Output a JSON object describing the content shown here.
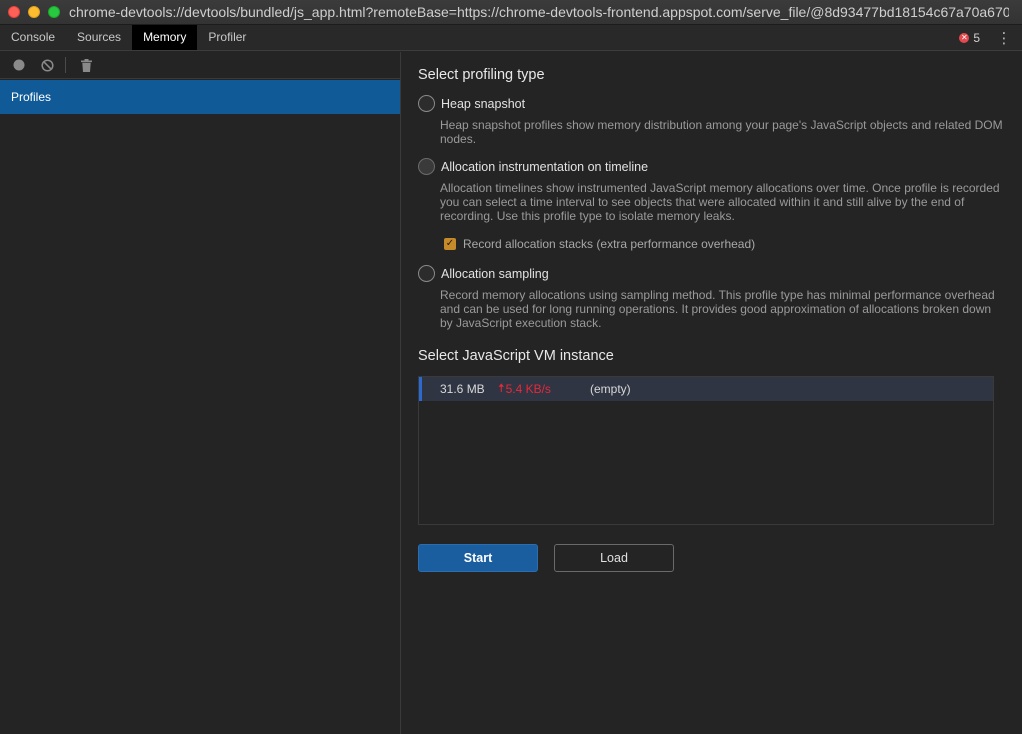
{
  "window": {
    "title": "chrome-devtools://devtools/bundled/js_app.html?remoteBase=https://chrome-devtools-frontend.appspot.com/serve_file/@8d93477bd18154c67a70a67019c..."
  },
  "tabs": [
    {
      "label": "Console"
    },
    {
      "label": "Sources"
    },
    {
      "label": "Memory"
    },
    {
      "label": "Profiler"
    }
  ],
  "error_count": "5",
  "sidebar": {
    "profiles_label": "Profiles"
  },
  "main": {
    "select_type_heading": "Select profiling type",
    "options": [
      {
        "label": "Heap snapshot",
        "description": "Heap snapshot profiles show memory distribution among your page's JavaScript objects and related DOM nodes."
      },
      {
        "label": "Allocation instrumentation on timeline",
        "description": "Allocation timelines show instrumented JavaScript memory allocations over time. Once profile is recorded you can select a time interval to see objects that were allocated within it and still alive by the end of recording. Use this profile type to isolate memory leaks."
      },
      {
        "label": "Allocation sampling",
        "description": "Record memory allocations using sampling method. This profile type has minimal performance overhead and can be used for long running operations. It provides good approximation of allocations broken down by JavaScript execution stack."
      }
    ],
    "record_stacks_label": "Record allocation stacks (extra performance overhead)",
    "vm_heading": "Select JavaScript VM instance",
    "vm_instance": {
      "size": "31.6 MB",
      "rate": "5.4 KB/s",
      "name": "(empty)"
    },
    "start_label": "Start",
    "load_label": "Load"
  },
  "colors": {
    "accent": "#105a98",
    "rate_up": "#e8283a",
    "checkbox": "#c58a2a"
  }
}
